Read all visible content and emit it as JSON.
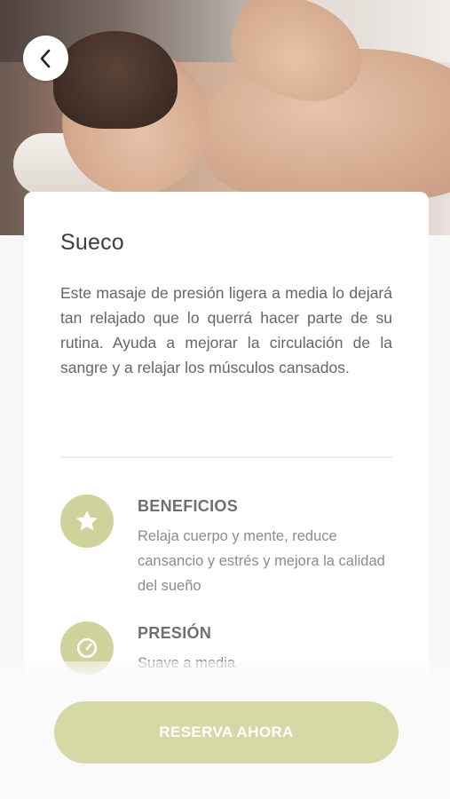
{
  "header": {
    "back_icon": "chevron-left-icon",
    "hero_image": "massage-photo"
  },
  "service": {
    "title": "Sueco",
    "description": "Este masaje de presión ligera a media lo dejará tan relajado que lo querrá hacer parte de su rutina. Ayuda a mejorar la circulación de la sangre y a relajar los músculos cansados."
  },
  "features": [
    {
      "icon": "star-icon",
      "title": "BENEFICIOS",
      "text": "Relaja cuerpo y mente, reduce cansancio y estrés y mejora la calidad del sueño"
    },
    {
      "icon": "gauge-icon",
      "title": "PRESIÓN",
      "text": "Suave a media"
    }
  ],
  "actions": {
    "reserve_label": "RESERVA AHORA"
  },
  "colors": {
    "accent": "#cfd39b",
    "button": "#d5d9a6",
    "background": "#f7f7f7",
    "card": "#ffffff"
  }
}
